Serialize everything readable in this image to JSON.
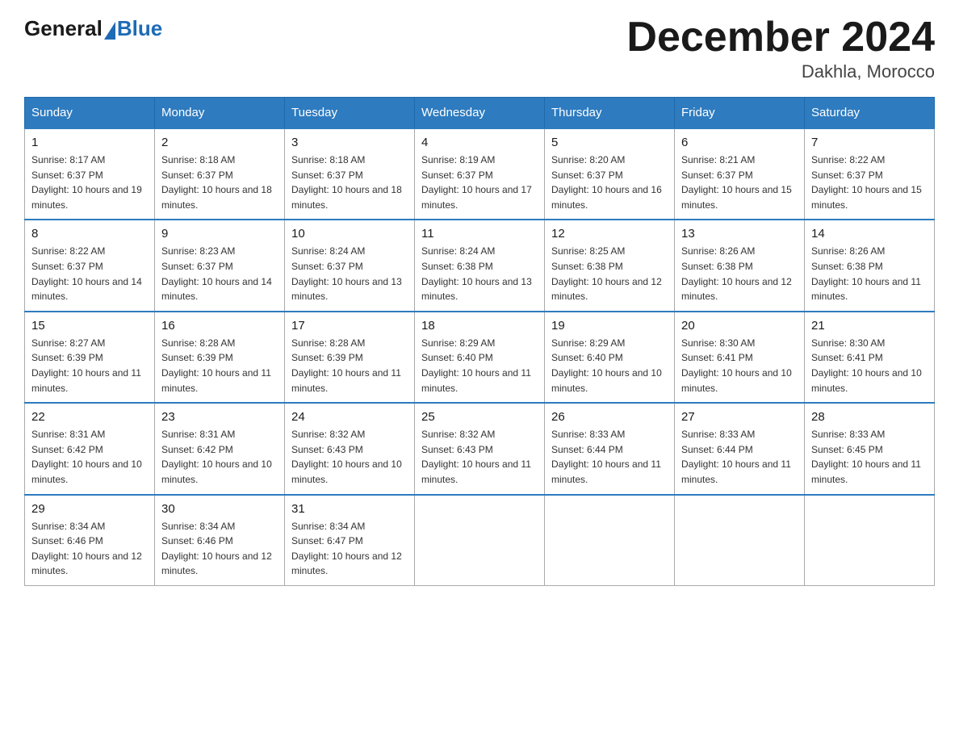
{
  "header": {
    "logo_general": "General",
    "logo_blue": "Blue",
    "month_title": "December 2024",
    "location": "Dakhla, Morocco"
  },
  "days_of_week": [
    "Sunday",
    "Monday",
    "Tuesday",
    "Wednesday",
    "Thursday",
    "Friday",
    "Saturday"
  ],
  "weeks": [
    [
      {
        "day": "1",
        "sunrise": "8:17 AM",
        "sunset": "6:37 PM",
        "daylight": "10 hours and 19 minutes."
      },
      {
        "day": "2",
        "sunrise": "8:18 AM",
        "sunset": "6:37 PM",
        "daylight": "10 hours and 18 minutes."
      },
      {
        "day": "3",
        "sunrise": "8:18 AM",
        "sunset": "6:37 PM",
        "daylight": "10 hours and 18 minutes."
      },
      {
        "day": "4",
        "sunrise": "8:19 AM",
        "sunset": "6:37 PM",
        "daylight": "10 hours and 17 minutes."
      },
      {
        "day": "5",
        "sunrise": "8:20 AM",
        "sunset": "6:37 PM",
        "daylight": "10 hours and 16 minutes."
      },
      {
        "day": "6",
        "sunrise": "8:21 AM",
        "sunset": "6:37 PM",
        "daylight": "10 hours and 15 minutes."
      },
      {
        "day": "7",
        "sunrise": "8:22 AM",
        "sunset": "6:37 PM",
        "daylight": "10 hours and 15 minutes."
      }
    ],
    [
      {
        "day": "8",
        "sunrise": "8:22 AM",
        "sunset": "6:37 PM",
        "daylight": "10 hours and 14 minutes."
      },
      {
        "day": "9",
        "sunrise": "8:23 AM",
        "sunset": "6:37 PM",
        "daylight": "10 hours and 14 minutes."
      },
      {
        "day": "10",
        "sunrise": "8:24 AM",
        "sunset": "6:37 PM",
        "daylight": "10 hours and 13 minutes."
      },
      {
        "day": "11",
        "sunrise": "8:24 AM",
        "sunset": "6:38 PM",
        "daylight": "10 hours and 13 minutes."
      },
      {
        "day": "12",
        "sunrise": "8:25 AM",
        "sunset": "6:38 PM",
        "daylight": "10 hours and 12 minutes."
      },
      {
        "day": "13",
        "sunrise": "8:26 AM",
        "sunset": "6:38 PM",
        "daylight": "10 hours and 12 minutes."
      },
      {
        "day": "14",
        "sunrise": "8:26 AM",
        "sunset": "6:38 PM",
        "daylight": "10 hours and 11 minutes."
      }
    ],
    [
      {
        "day": "15",
        "sunrise": "8:27 AM",
        "sunset": "6:39 PM",
        "daylight": "10 hours and 11 minutes."
      },
      {
        "day": "16",
        "sunrise": "8:28 AM",
        "sunset": "6:39 PM",
        "daylight": "10 hours and 11 minutes."
      },
      {
        "day": "17",
        "sunrise": "8:28 AM",
        "sunset": "6:39 PM",
        "daylight": "10 hours and 11 minutes."
      },
      {
        "day": "18",
        "sunrise": "8:29 AM",
        "sunset": "6:40 PM",
        "daylight": "10 hours and 11 minutes."
      },
      {
        "day": "19",
        "sunrise": "8:29 AM",
        "sunset": "6:40 PM",
        "daylight": "10 hours and 10 minutes."
      },
      {
        "day": "20",
        "sunrise": "8:30 AM",
        "sunset": "6:41 PM",
        "daylight": "10 hours and 10 minutes."
      },
      {
        "day": "21",
        "sunrise": "8:30 AM",
        "sunset": "6:41 PM",
        "daylight": "10 hours and 10 minutes."
      }
    ],
    [
      {
        "day": "22",
        "sunrise": "8:31 AM",
        "sunset": "6:42 PM",
        "daylight": "10 hours and 10 minutes."
      },
      {
        "day": "23",
        "sunrise": "8:31 AM",
        "sunset": "6:42 PM",
        "daylight": "10 hours and 10 minutes."
      },
      {
        "day": "24",
        "sunrise": "8:32 AM",
        "sunset": "6:43 PM",
        "daylight": "10 hours and 10 minutes."
      },
      {
        "day": "25",
        "sunrise": "8:32 AM",
        "sunset": "6:43 PM",
        "daylight": "10 hours and 11 minutes."
      },
      {
        "day": "26",
        "sunrise": "8:33 AM",
        "sunset": "6:44 PM",
        "daylight": "10 hours and 11 minutes."
      },
      {
        "day": "27",
        "sunrise": "8:33 AM",
        "sunset": "6:44 PM",
        "daylight": "10 hours and 11 minutes."
      },
      {
        "day": "28",
        "sunrise": "8:33 AM",
        "sunset": "6:45 PM",
        "daylight": "10 hours and 11 minutes."
      }
    ],
    [
      {
        "day": "29",
        "sunrise": "8:34 AM",
        "sunset": "6:46 PM",
        "daylight": "10 hours and 12 minutes."
      },
      {
        "day": "30",
        "sunrise": "8:34 AM",
        "sunset": "6:46 PM",
        "daylight": "10 hours and 12 minutes."
      },
      {
        "day": "31",
        "sunrise": "8:34 AM",
        "sunset": "6:47 PM",
        "daylight": "10 hours and 12 minutes."
      },
      null,
      null,
      null,
      null
    ]
  ]
}
